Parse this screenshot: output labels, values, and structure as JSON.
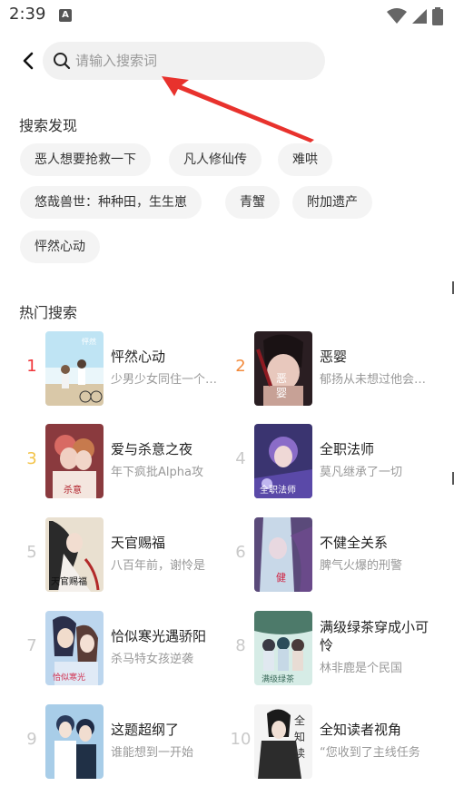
{
  "status": {
    "time": "2:39",
    "a_badge": "A"
  },
  "search": {
    "placeholder": "请输入搜索词"
  },
  "discover": {
    "title": "搜索发现",
    "chips": [
      "恶人想要抢救一下",
      "凡人修仙传",
      "难哄",
      "悠哉兽世：种种田，生生崽",
      "青蟹",
      "附加遗产",
      "怦然心动"
    ]
  },
  "hot": {
    "title": "热门搜索",
    "items": [
      {
        "rank": "1",
        "title": "怦然心动",
        "subtitle": "少男少女同住一个屋檐下"
      },
      {
        "rank": "2",
        "title": "恶婴",
        "subtitle": "郁扬从未想过他会变成"
      },
      {
        "rank": "3",
        "title": "爱与杀意之夜",
        "subtitle": "年下疯批Alpha攻"
      },
      {
        "rank": "4",
        "title": "全职法师",
        "subtitle": "莫凡继承了一切"
      },
      {
        "rank": "5",
        "title": "天官赐福",
        "subtitle": "八百年前，谢怜是"
      },
      {
        "rank": "6",
        "title": "不健全关系",
        "subtitle": "脾气火爆的刑警"
      },
      {
        "rank": "7",
        "title": "恰似寒光遇骄阳",
        "subtitle": "杀马特女孩逆袭"
      },
      {
        "rank": "8",
        "title": "满级绿茶穿成小可怜",
        "subtitle": "林非鹿是个民国"
      },
      {
        "rank": "9",
        "title": "这题超纲了",
        "subtitle": "谁能想到一开始"
      },
      {
        "rank": "10",
        "title": "全知读者视角",
        "subtitle": "“您收到了主线任务"
      }
    ]
  },
  "colors": {
    "rank1": "#f0353a",
    "rank2": "#f28a3c",
    "rank3": "#f3c44b",
    "arrow": "#e8322d"
  },
  "icons": [
    "back-arrow-icon",
    "search-icon",
    "wifi-icon",
    "signal-icon",
    "battery-icon"
  ]
}
